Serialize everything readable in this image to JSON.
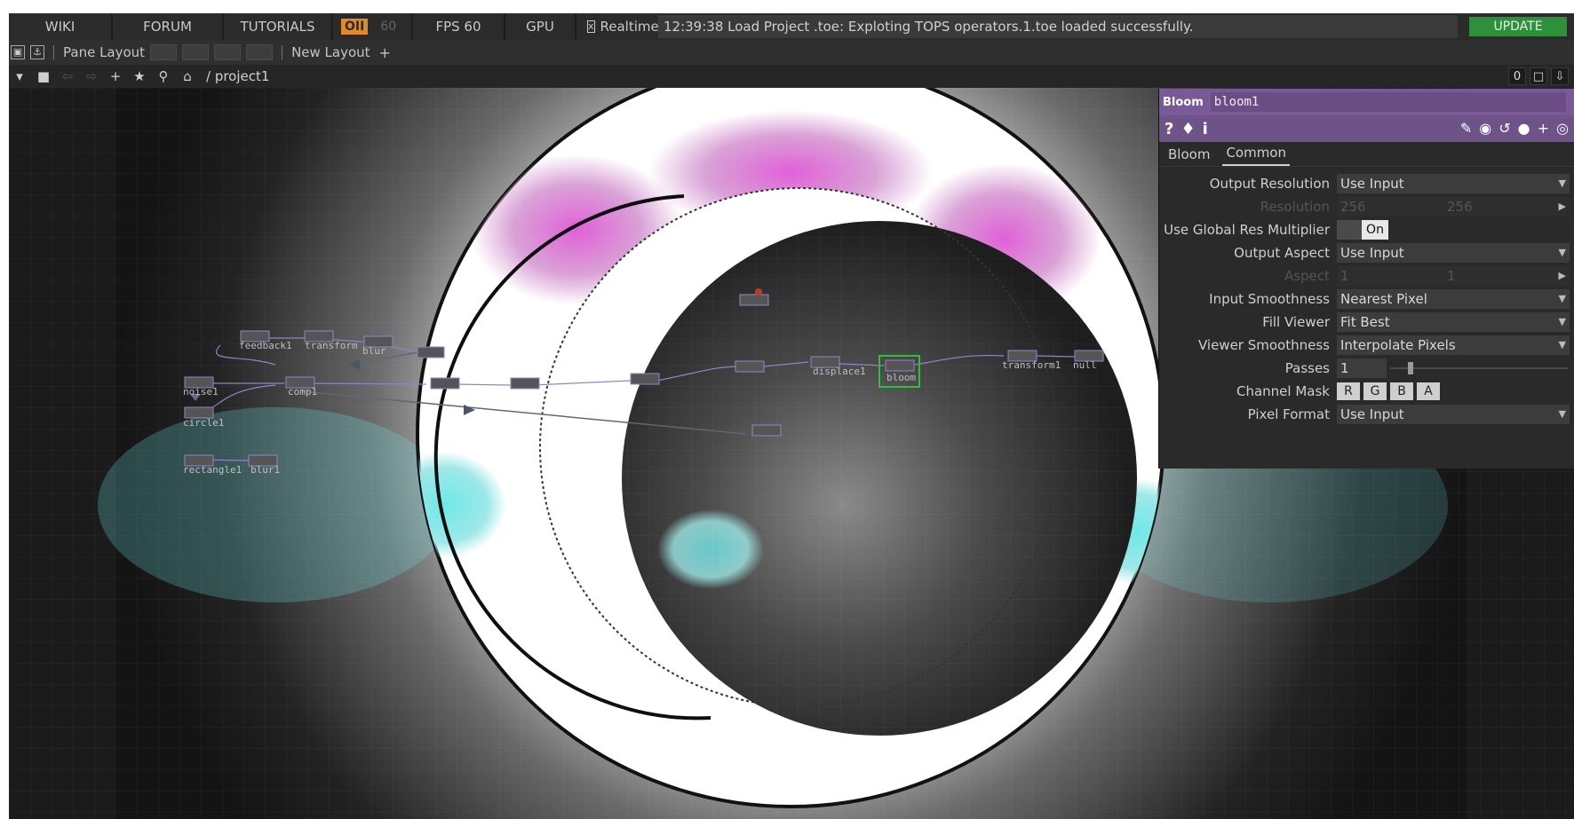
{
  "topbar": {
    "wiki": "WIKI",
    "forum": "FORUM",
    "tutorials": "TUTORIALS",
    "oi": "OII",
    "fps_cap": "60",
    "fps": "FPS  60",
    "gpu": "GPU",
    "realtime_check": "x",
    "realtime": "Realtime",
    "status": "12:39:38 Load Project .toe: Exploting TOPS operators.1.toe loaded successfully.",
    "update": "UPDATE"
  },
  "panebar": {
    "pane_layout": "Pane Layout",
    "new_layout": "New Layout",
    "add": "+"
  },
  "navbar": {
    "path": "/ project1",
    "right_value": "0"
  },
  "network": {
    "operators": {
      "feedback1": "feedback1",
      "transform": "transform",
      "blur": "blur",
      "noise1": "noise1",
      "comp": "comp1",
      "circle1": "circle1",
      "rectangle1": "rectangle1",
      "blur1": "blur1",
      "bloom": "bloom",
      "displace1": "displace1",
      "transform1": "transform1",
      "null": "null"
    }
  },
  "params": {
    "type": "Bloom",
    "name": "bloom1",
    "tabs": [
      "Bloom",
      "Common"
    ],
    "active_tab": "Common",
    "rows": {
      "output_resolution": {
        "label": "Output Resolution",
        "value": "Use Input"
      },
      "resolution": {
        "label": "Resolution",
        "value1": "256",
        "value2": "256"
      },
      "global_res": {
        "label": "Use Global Res Multiplier",
        "value": "On"
      },
      "output_aspect": {
        "label": "Output Aspect",
        "value": "Use Input"
      },
      "aspect": {
        "label": "Aspect",
        "value1": "1",
        "value2": "1"
      },
      "input_smoothness": {
        "label": "Input Smoothness",
        "value": "Nearest Pixel"
      },
      "fill_viewer": {
        "label": "Fill Viewer",
        "value": "Fit Best"
      },
      "viewer_smoothness": {
        "label": "Viewer Smoothness",
        "value": "Interpolate Pixels"
      },
      "passes": {
        "label": "Passes",
        "value": "1"
      },
      "channel_mask": {
        "label": "Channel Mask",
        "channels": [
          "R",
          "G",
          "B",
          "A"
        ]
      },
      "pixel_format": {
        "label": "Pixel Format",
        "value": "Use Input"
      }
    }
  },
  "colors": {
    "accent_orange": "#e0892d",
    "update_green": "#2f8f3a",
    "param_header": "#7a5a96",
    "selected_node": "#2fbf3a",
    "pink_blob": "#e060d8",
    "cyan_blob": "#6ee8e8"
  }
}
